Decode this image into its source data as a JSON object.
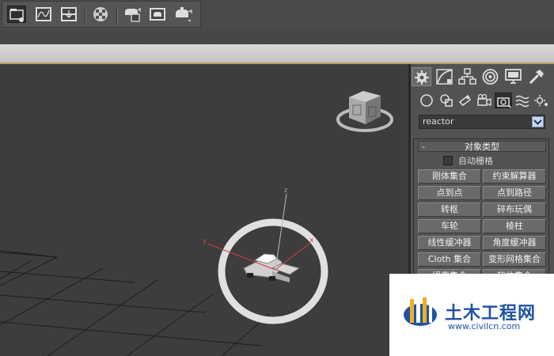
{
  "toolbar": {
    "buttons": [
      {
        "name": "named-selection-icon",
        "active": true
      },
      {
        "name": "curve-editor-icon",
        "active": false
      },
      {
        "name": "schematic-view-icon",
        "active": false
      },
      {
        "name": "material-editor-icon",
        "active": false
      },
      {
        "name": "render-setup-icon",
        "active": false
      },
      {
        "name": "rendered-frame-icon",
        "active": false
      },
      {
        "name": "quick-render-icon",
        "active": false
      }
    ]
  },
  "viewport": {
    "axis_x": "x",
    "axis_y": "y",
    "axis_z": "z"
  },
  "command_panel": {
    "tabs": [
      "create-tab",
      "modify-tab",
      "hierarchy-tab",
      "motion-tab",
      "display-tab",
      "utilities-tab"
    ],
    "categories": [
      "geometry",
      "shapes",
      "lights",
      "cameras",
      "helpers",
      "space-warps",
      "systems"
    ],
    "dropdown_value": "reactor",
    "rollout": {
      "toggle": "-",
      "title": "对象类型",
      "autogrid_label": "自动栅格",
      "buttons": [
        "刚体集合",
        "约束解算器",
        "点到点",
        "点到路径",
        "转枢",
        "碎布玩偶",
        "车轮",
        "棱柱",
        "线性缓冲器",
        "角度缓冲器",
        "Cloth 集合",
        "变形网格集合",
        "绳索集合",
        "软体集合"
      ]
    }
  },
  "watermark": {
    "name": "土木工程网",
    "url": "www.civilcn.com"
  }
}
